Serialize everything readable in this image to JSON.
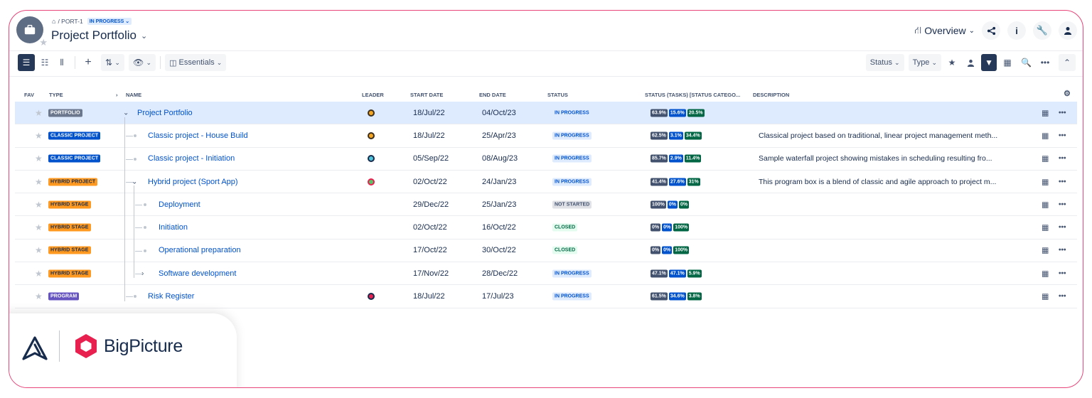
{
  "breadcrumb": {
    "project_key": "/ PORT-1",
    "status": "IN PROGRESS ⌄"
  },
  "title": "Project Portfolio",
  "header": {
    "view": "Overview"
  },
  "toolbar": {
    "essentials": "Essentials",
    "status_filter": "Status",
    "type_filter": "Type"
  },
  "columns": {
    "fav": "FAV",
    "type": "TYPE",
    "name": "NAME",
    "leader": "LEADER",
    "start": "START DATE",
    "end": "END DATE",
    "status": "STATUS",
    "status_tasks": "STATUS (TASKS) [STATUS CATEGO...",
    "description": "DESCRIPTION"
  },
  "rows": [
    {
      "type": "PORTFOLIO",
      "name": "Project Portfolio",
      "start": "18/Jul/22",
      "end": "04/Oct/23",
      "status": "IN PROGRESS",
      "bars": [
        "63.9%",
        "15.6%",
        "20.5%"
      ],
      "desc": ""
    },
    {
      "type": "CLASSIC PROJECT",
      "name": "Classic project - House Build",
      "start": "18/Jul/22",
      "end": "25/Apr/23",
      "status": "IN PROGRESS",
      "bars": [
        "62.5%",
        "3.1%",
        "34.4%"
      ],
      "desc": "Classical project based on traditional, linear project management meth..."
    },
    {
      "type": "CLASSIC PROJECT",
      "name": "Classic project - Initiation",
      "start": "05/Sep/22",
      "end": "08/Aug/23",
      "status": "IN PROGRESS",
      "bars": [
        "85.7%",
        "2.9%",
        "11.4%"
      ],
      "desc": "Sample waterfall project showing mistakes in scheduling resulting fro..."
    },
    {
      "type": "HYBRID PROJECT",
      "name": "Hybrid project (Sport App)",
      "start": "02/Oct/22",
      "end": "24/Jan/23",
      "status": "IN PROGRESS",
      "bars": [
        "41.4%",
        "27.6%",
        "31%"
      ],
      "desc": "This program box is a blend of classic and agile approach to project m..."
    },
    {
      "type": "HYBRID STAGE",
      "name": "Deployment",
      "start": "29/Dec/22",
      "end": "25/Jan/23",
      "status": "NOT STARTED",
      "bars": [
        "100%",
        "0%",
        "0%"
      ],
      "desc": ""
    },
    {
      "type": "HYBRID STAGE",
      "name": "Initiation",
      "start": "02/Oct/22",
      "end": "16/Oct/22",
      "status": "CLOSED",
      "bars": [
        "0%",
        "0%",
        "100%"
      ],
      "desc": ""
    },
    {
      "type": "HYBRID STAGE",
      "name": "Operational preparation",
      "start": "17/Oct/22",
      "end": "30/Oct/22",
      "status": "CLOSED",
      "bars": [
        "0%",
        "0%",
        "100%"
      ],
      "desc": ""
    },
    {
      "type": "HYBRID STAGE",
      "name": "Software development",
      "start": "17/Nov/22",
      "end": "28/Dec/22",
      "status": "IN PROGRESS",
      "bars": [
        "47.1%",
        "47.1%",
        "5.9%"
      ],
      "desc": ""
    },
    {
      "type": "PROGRAM",
      "name": "Risk Register",
      "start": "18/Jul/22",
      "end": "17/Jul/23",
      "status": "IN PROGRESS",
      "bars": [
        "61.5%",
        "34.6%",
        "3.8%"
      ],
      "desc": ""
    }
  ],
  "branding": {
    "name": "BigPicture"
  },
  "colors": {
    "accent": "#0052cc",
    "frame": "#e8457a",
    "brand": "#e8204f"
  }
}
